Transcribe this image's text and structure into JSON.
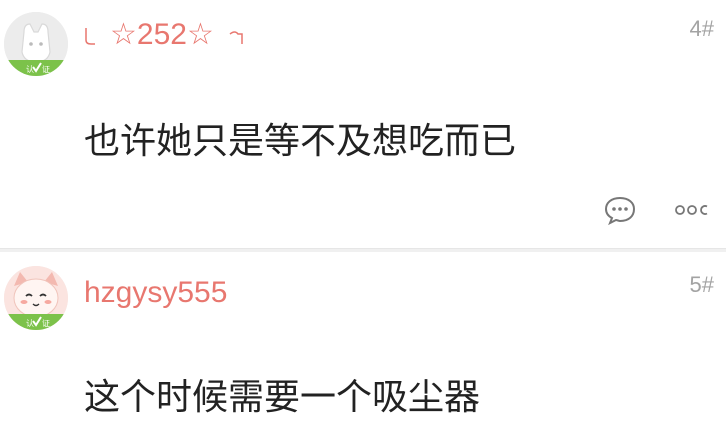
{
  "posts": [
    {
      "username": "☆252☆",
      "floor": "4#",
      "content": "也许她只是等不及想吃而已",
      "username_color": "#e8776f",
      "badge_text": "认证",
      "actions": [
        "comment-icon",
        "more-icon"
      ]
    },
    {
      "username": "hzgysy555",
      "floor": "5#",
      "content": "这个时候需要一个吸尘器",
      "username_color": "#e8776f",
      "badge_text": "认证"
    }
  ],
  "colors": {
    "accent": "#e8776f",
    "badge_green": "#7cc24a",
    "text": "#222222",
    "meta": "#a3a3a3"
  }
}
